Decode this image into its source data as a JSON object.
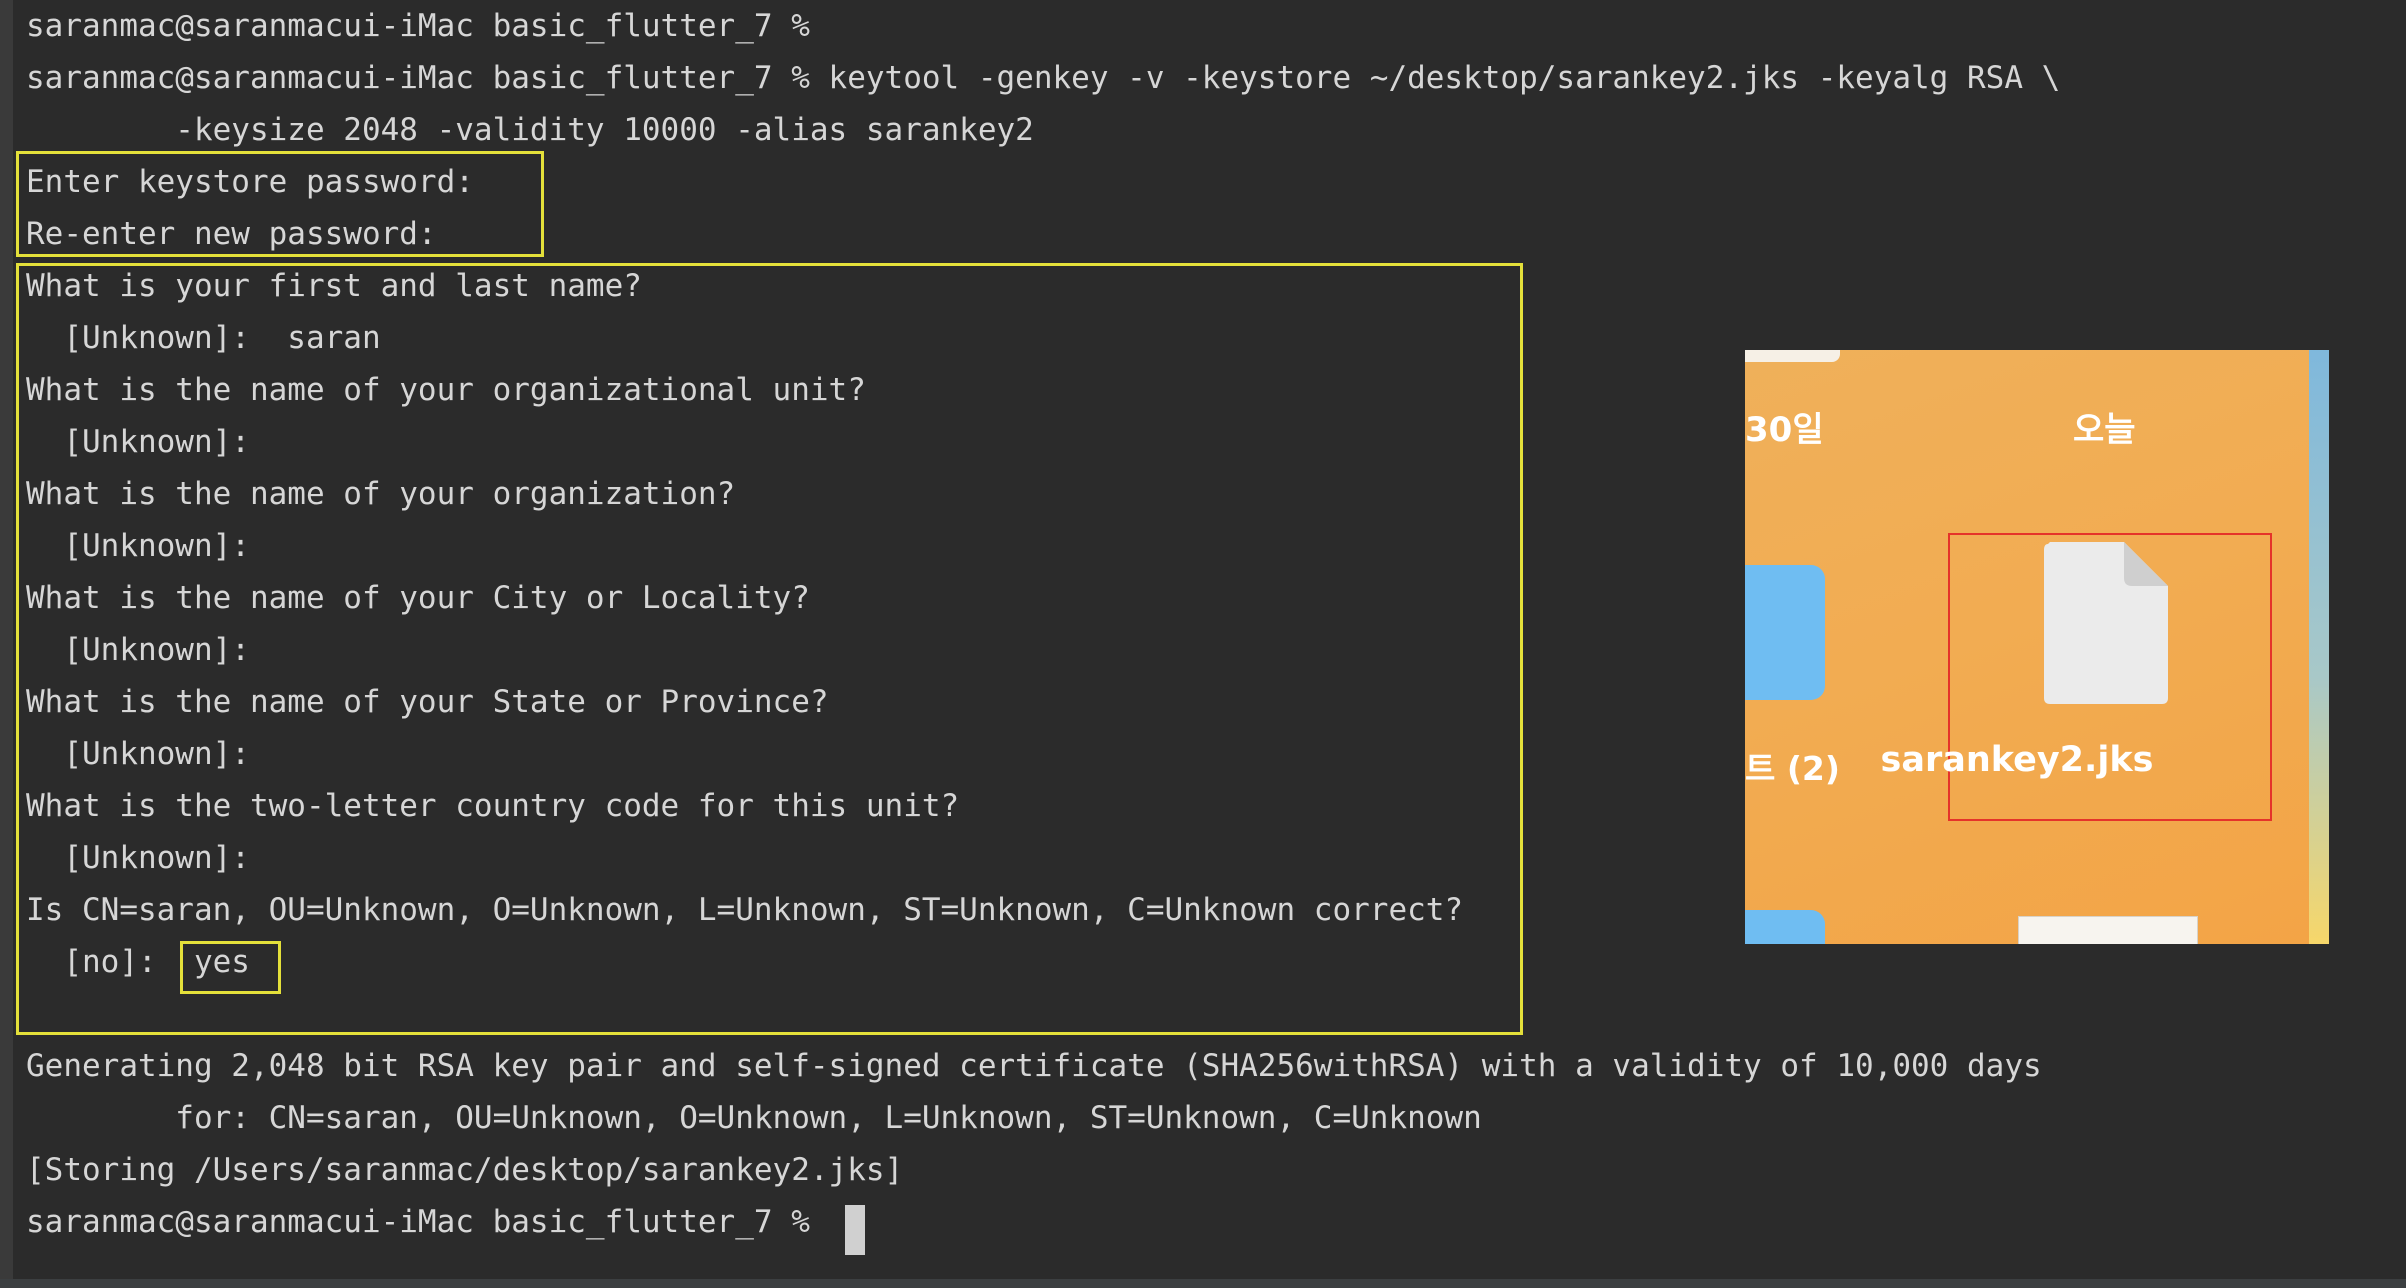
{
  "terminal": {
    "lines": [
      "saranmac@saranmacui-iMac basic_flutter_7 %",
      "saranmac@saranmacui-iMac basic_flutter_7 % keytool -genkey -v -keystore ~/desktop/sarankey2.jks -keyalg RSA \\",
      "        -keysize 2048 -validity 10000 -alias sarankey2",
      "Enter keystore password:",
      "Re-enter new password:",
      "What is your first and last name?",
      "  [Unknown]:  saran",
      "What is the name of your organizational unit?",
      "  [Unknown]:",
      "What is the name of your organization?",
      "  [Unknown]:",
      "What is the name of your City or Locality?",
      "  [Unknown]:",
      "What is the name of your State or Province?",
      "  [Unknown]:",
      "What is the two-letter country code for this unit?",
      "  [Unknown]:",
      "Is CN=saran, OU=Unknown, O=Unknown, L=Unknown, ST=Unknown, C=Unknown correct?",
      "  [no]:  yes",
      "",
      "Generating 2,048 bit RSA key pair and self-signed certificate (SHA256withRSA) with a validity of 10,000 days",
      "        for: CN=saran, OU=Unknown, O=Unknown, L=Unknown, ST=Unknown, C=Unknown",
      "[Storing /Users/saranmac/desktop/sarankey2.jks]",
      "saranmac@saranmacui-iMac basic_flutter_7 %"
    ]
  },
  "finder": {
    "date_left": "30일",
    "date_right": "오늘",
    "folder_label": "트 (2)",
    "file_name": "sarankey2.jks"
  },
  "colors": {
    "background": "#2b2b2b",
    "text": "#d6d6d6",
    "highlight_box": "#e4e03a",
    "file_highlight": "#e5332a",
    "desktop_orange": "#f2ac52",
    "folder_blue": "#6fbdf2"
  },
  "icons": [
    "document-icon",
    "folder-icon"
  ]
}
